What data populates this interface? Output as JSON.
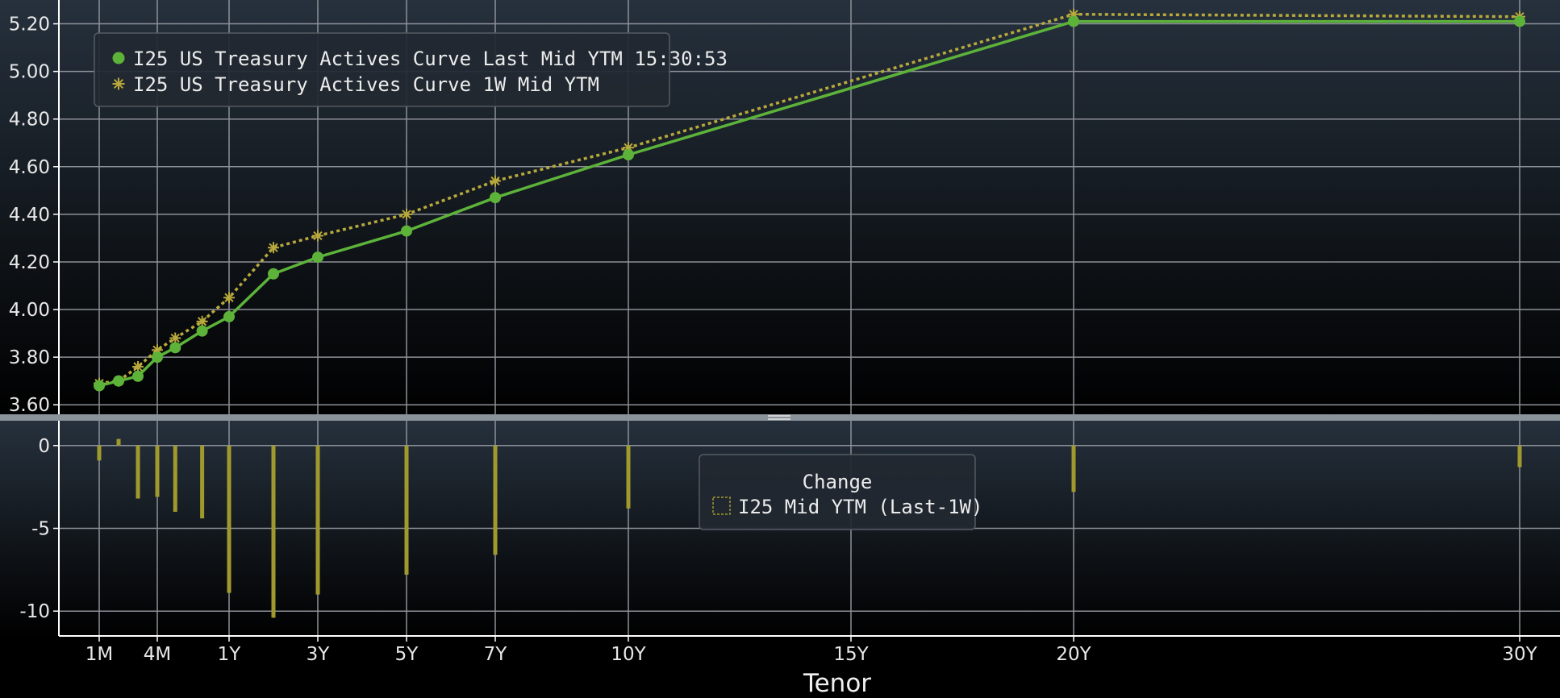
{
  "chart_data": [
    {
      "type": "line",
      "ylim": [
        3.55,
        5.3
      ],
      "yticks": [
        "3.60",
        "3.80",
        "4.00",
        "4.20",
        "4.40",
        "4.60",
        "4.80",
        "5.00",
        "5.20"
      ],
      "legend_position": "top-left",
      "grid": true,
      "series": [
        {
          "name": "I25 US Treasury Actives Curve Last Mid YTM 15:30:53",
          "color": "#5db33a",
          "marker": "circle",
          "line": "solid",
          "tenors_years": [
            0.0833,
            0.1667,
            0.25,
            0.3333,
            0.5,
            0.75,
            1,
            2,
            3,
            5,
            7,
            10,
            20,
            30
          ],
          "values": [
            3.68,
            3.7,
            3.72,
            3.8,
            3.84,
            3.91,
            3.97,
            4.15,
            4.22,
            4.33,
            4.47,
            4.65,
            5.21,
            5.21
          ]
        },
        {
          "name": "I25 US Treasury Actives Curve 1W Mid YTM",
          "color": "#b8a93c",
          "marker": "star",
          "line": "dotted",
          "tenors_years": [
            0.0833,
            0.1667,
            0.25,
            0.3333,
            0.5,
            0.75,
            1,
            2,
            3,
            5,
            7,
            10,
            20,
            30
          ],
          "values": [
            3.69,
            3.7,
            3.76,
            3.83,
            3.88,
            3.95,
            4.05,
            4.26,
            4.31,
            4.4,
            4.54,
            4.68,
            5.24,
            5.23
          ]
        }
      ]
    },
    {
      "type": "bar",
      "ylim": [
        -11.5,
        1.5
      ],
      "yticks": [
        "0",
        "-5",
        "-10"
      ],
      "legend_title": "Change",
      "legend_position": "center",
      "grid": true,
      "series": [
        {
          "name": "I25 Mid YTM (Last-1W)",
          "color": "#a09a2e",
          "tenors_years": [
            0.0833,
            0.1667,
            0.25,
            0.3333,
            0.5,
            0.75,
            1,
            2,
            3,
            5,
            7,
            10,
            20,
            30
          ],
          "values": [
            -0.9,
            0.4,
            -3.2,
            -3.1,
            -4.0,
            -4.4,
            -8.9,
            -10.4,
            -9.0,
            -7.8,
            -6.6,
            -3.8,
            -2.8,
            -1.3
          ]
        }
      ]
    }
  ],
  "x_axis": {
    "label": "Tenor",
    "ticks": [
      {
        "label": "1M",
        "years": 0.0833
      },
      {
        "label": "4M",
        "years": 0.3333
      },
      {
        "label": "1Y",
        "years": 1
      },
      {
        "label": "3Y",
        "years": 3
      },
      {
        "label": "5Y",
        "years": 5
      },
      {
        "label": "7Y",
        "years": 7
      },
      {
        "label": "10Y",
        "years": 10
      },
      {
        "label": "15Y",
        "years": 15
      },
      {
        "label": "20Y",
        "years": 20
      },
      {
        "label": "30Y",
        "years": 30
      }
    ]
  }
}
